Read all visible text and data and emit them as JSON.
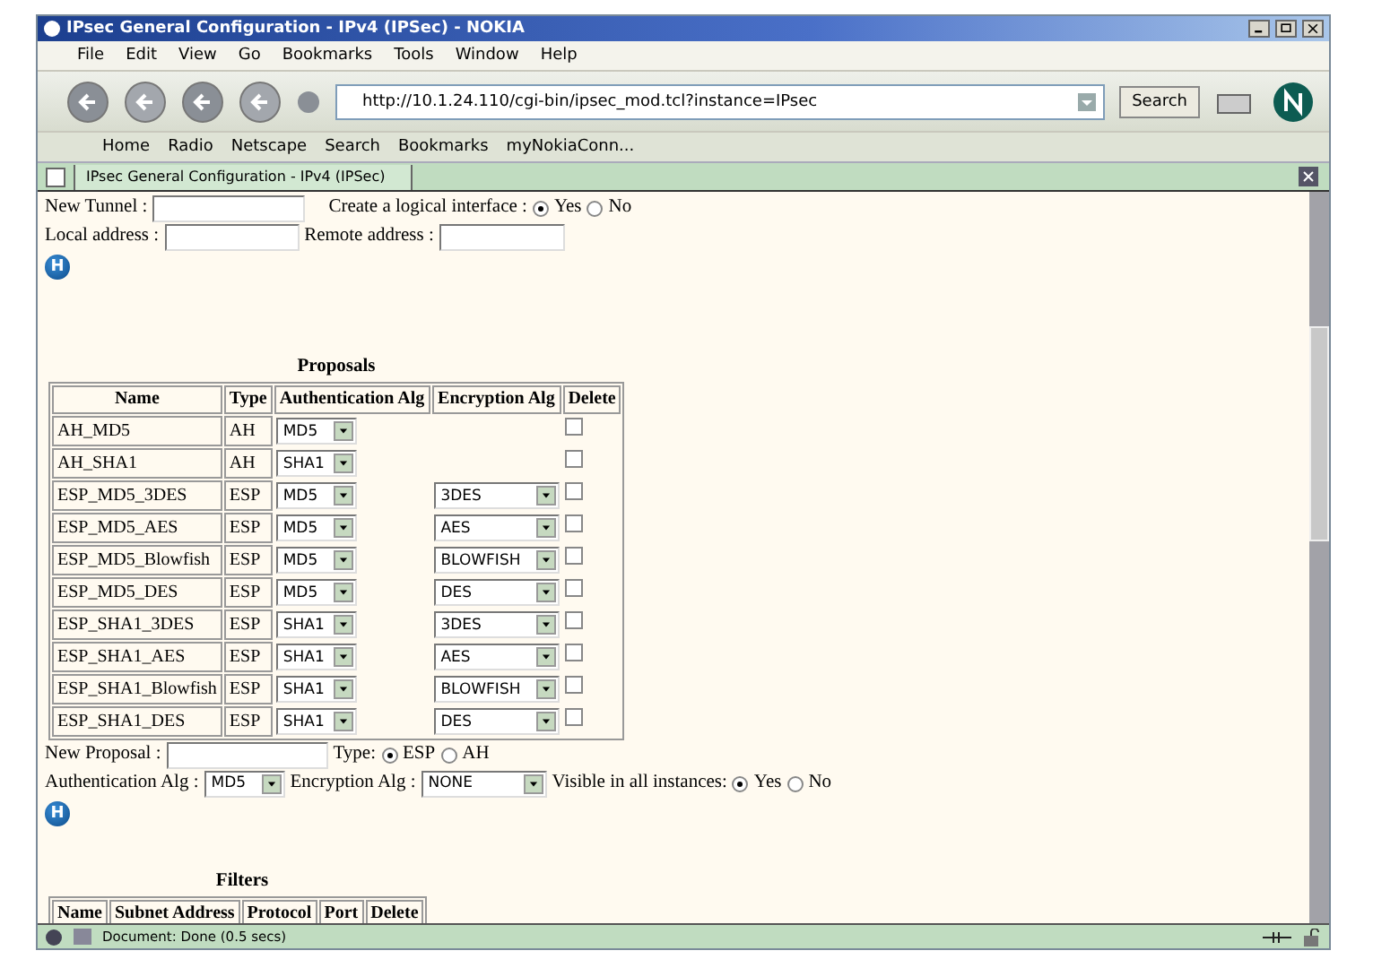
{
  "window": {
    "title": "IPsec General Configuration - IPv4 (IPSec) - NOKIA"
  },
  "menu": [
    "File",
    "Edit",
    "View",
    "Go",
    "Bookmarks",
    "Tools",
    "Window",
    "Help"
  ],
  "nav_toolbar": {
    "url": "http://10.1.24.110/cgi-bin/ipsec_mod.tcl?instance=IPsec",
    "search_button": "Search"
  },
  "personal_toolbar": [
    "Home",
    "Radio",
    "Netscape",
    "Search",
    "Bookmarks",
    "myNokiaConn..."
  ],
  "tabs": [
    {
      "label": "IPsec General Configuration - IPv4 (IPSec)",
      "selected": true
    }
  ],
  "tunnel_form": {
    "new_tunnel_label": "New Tunnel :",
    "logical_interface_label": "Create a logical interface :",
    "logical_interface_options": [
      {
        "label": "Yes",
        "selected": true
      },
      {
        "label": "No",
        "selected": false
      }
    ],
    "local_address_label": "Local address :",
    "remote_address_label": "Remote address :",
    "help_icon": "H"
  },
  "proposals": {
    "title": "Proposals",
    "columns": [
      "Name",
      "Type",
      "Authentication Alg",
      "Encryption Alg",
      "Delete"
    ],
    "rows": [
      {
        "name": "AH_MD5",
        "type": "AH",
        "auth": "MD5",
        "delete": false
      },
      {
        "name": "AH_SHA1",
        "type": "AH",
        "auth": "SHA1",
        "delete": false
      },
      {
        "name": "ESP_MD5_3DES",
        "type": "ESP",
        "auth": "MD5",
        "encryption": "3DES",
        "delete": false
      },
      {
        "name": "ESP_MD5_AES",
        "type": "ESP",
        "auth": "MD5",
        "encryption": "AES",
        "delete": false
      },
      {
        "name": "ESP_MD5_Blowfish",
        "type": "ESP",
        "auth": "MD5",
        "encryption": "BLOWFISH",
        "delete": false
      },
      {
        "name": "ESP_MD5_DES",
        "type": "ESP",
        "auth": "MD5",
        "encryption": "DES",
        "delete": false
      },
      {
        "name": "ESP_SHA1_3DES",
        "type": "ESP",
        "auth": "SHA1",
        "encryption": "3DES",
        "delete": false
      },
      {
        "name": "ESP_SHA1_AES",
        "type": "ESP",
        "auth": "SHA1",
        "encryption": "AES",
        "delete": false
      },
      {
        "name": "ESP_SHA1_Blowfish",
        "type": "ESP",
        "auth": "SHA1",
        "encryption": "BLOWFISH",
        "delete": false
      },
      {
        "name": "ESP_SHA1_DES",
        "type": "ESP",
        "auth": "SHA1",
        "encryption": "DES",
        "delete": false
      }
    ]
  },
  "new_proposal": {
    "label": "New Proposal :",
    "type_label": "Type:",
    "type_options": [
      {
        "label": "ESP",
        "selected": true
      },
      {
        "label": "AH",
        "selected": false
      }
    ],
    "auth_label": "Authentication Alg :",
    "auth_value": "MD5",
    "encryption_label": "Encryption Alg :",
    "encryption_value": "NONE",
    "visible_label": "Visible in all instances:",
    "visible_options": [
      {
        "label": "Yes",
        "selected": true
      },
      {
        "label": "No",
        "selected": false
      }
    ],
    "help_icon": "H"
  },
  "filters": {
    "title": "Filters",
    "columns": [
      "Name",
      "Subnet Address",
      "Protocol",
      "Port",
      "Delete"
    ]
  },
  "status_bar": {
    "text": "Document: Done (0.5 secs)"
  }
}
